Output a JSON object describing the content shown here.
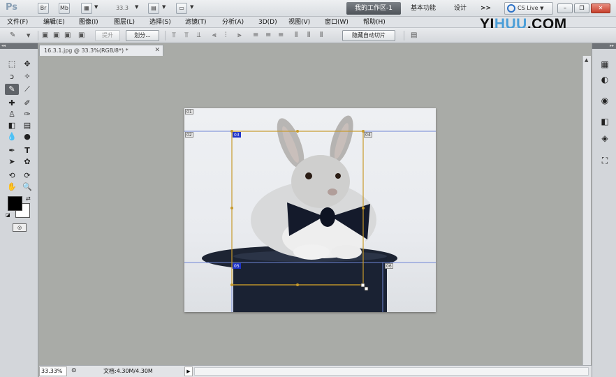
{
  "appbar": {
    "logo": "Ps",
    "br_label": "Br",
    "mb_label": "Mb",
    "zoom_value": "33.3",
    "workspaces": {
      "active": "我的工作区-1",
      "basic": "基本功能",
      "design": "设计",
      "more": ">>"
    },
    "cs_live": "CS Live"
  },
  "menu": {
    "items": [
      "文件(F)",
      "编辑(E)",
      "图像(I)",
      "图层(L)",
      "选择(S)",
      "滤镜(T)",
      "分析(A)",
      "3D(D)",
      "视图(V)",
      "窗口(W)",
      "帮助(H)"
    ]
  },
  "watermark": {
    "part1": "YI",
    "part2": "HUU",
    "part3": ".COM"
  },
  "options": {
    "promote_label": "提升",
    "divide_label": "划分...",
    "hide_auto_slices_label": "隐藏自动切片"
  },
  "document": {
    "tab_title": "16.3.1.jpg @ 33.3%(RGB/8*) *",
    "slice_labels": {
      "s1": "01",
      "s2": "02",
      "s3": "03",
      "s4": "04",
      "s5": "05",
      "s6": "06"
    }
  },
  "status": {
    "zoom": "33.33%",
    "doc_info": "文档:4.30M/4.30M"
  },
  "icons": [
    "photoshop-logo",
    "bridge-icon",
    "mini-bridge-icon",
    "screen-mode-icon",
    "arrange-icon",
    "cs-live-icon",
    "slice-tool-icon",
    "move-tool-icon",
    "marquee-tool-icon",
    "lasso-tool-icon",
    "crop-tool-icon",
    "brush-tool-icon",
    "eraser-tool-icon",
    "type-tool-icon",
    "pen-tool-icon",
    "hand-tool-icon",
    "zoom-tool-icon"
  ]
}
